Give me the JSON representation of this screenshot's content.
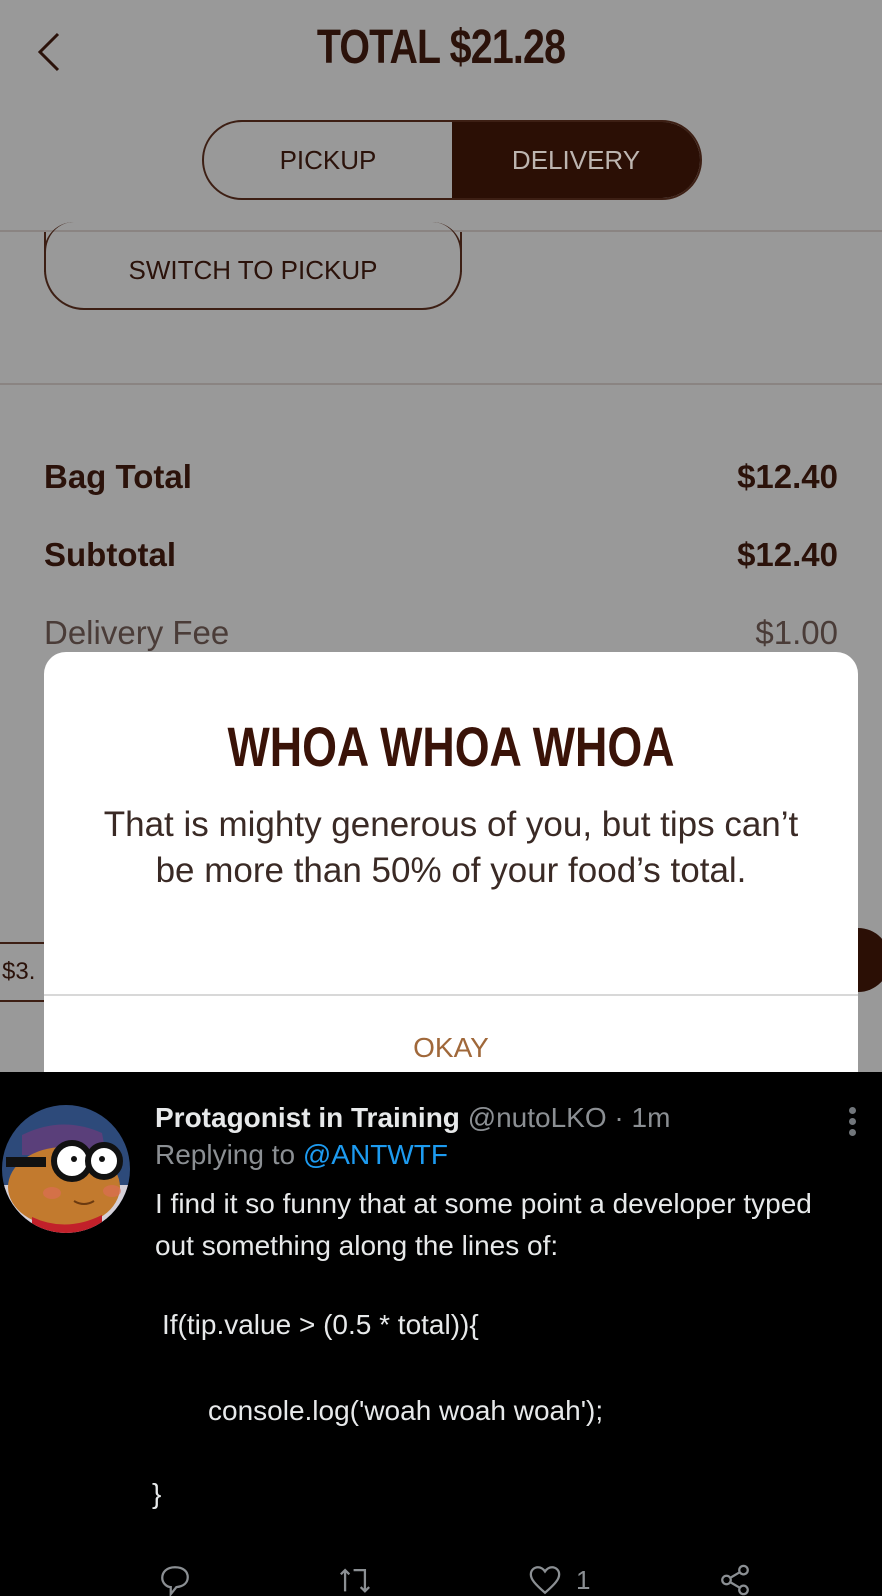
{
  "app": {
    "header": {
      "back_icon": "chevron-left-icon",
      "title": "TOTAL $21.28"
    },
    "order_type": {
      "options": [
        {
          "label": "PICKUP",
          "selected": false
        },
        {
          "label": "DELIVERY",
          "selected": true
        }
      ]
    },
    "switch_button_label": "SWITCH TO PICKUP",
    "summary": [
      {
        "label": "Bag Total",
        "value": "$12.40"
      },
      {
        "label": "Subtotal",
        "value": "$12.40"
      },
      {
        "label": "Delivery Fee",
        "value": "$1.00"
      }
    ],
    "tip_partial_value": "$3.",
    "dialog": {
      "title": "WHOA WHOA WHOA",
      "message": "That is mighty generous of you, but tips can’t be more than 50% of your food’s total.",
      "ok_label": "OKAY"
    },
    "colors": {
      "brand_dark": "#2b0f05",
      "dialog_title": "#3a1308",
      "ok_button": "#a0683a",
      "overlay_bg": "#999999"
    }
  },
  "tweet": {
    "display_name": "Protagonist in Training",
    "handle_time": "@nutoLKO · 1m",
    "replying_prefix": "Replying to",
    "replying_to": "@ANTWTF",
    "text": "I find it so funny that at some point a developer typed out something along the lines of:",
    "code_lines": [
      "If(tip.value > (0.5 * total)){",
      "console.log('woah woah woah');",
      "}"
    ],
    "more_icon": "more-vertical-icon",
    "actions": [
      {
        "icon": "reply-icon",
        "count": ""
      },
      {
        "icon": "retweet-icon",
        "count": ""
      },
      {
        "icon": "heart-icon",
        "count": "1"
      },
      {
        "icon": "share-icon",
        "count": ""
      }
    ],
    "colors": {
      "mention": "#1d9bf0",
      "secondary_text": "#8b8f93",
      "primary_text": "#e7e9ea"
    }
  }
}
